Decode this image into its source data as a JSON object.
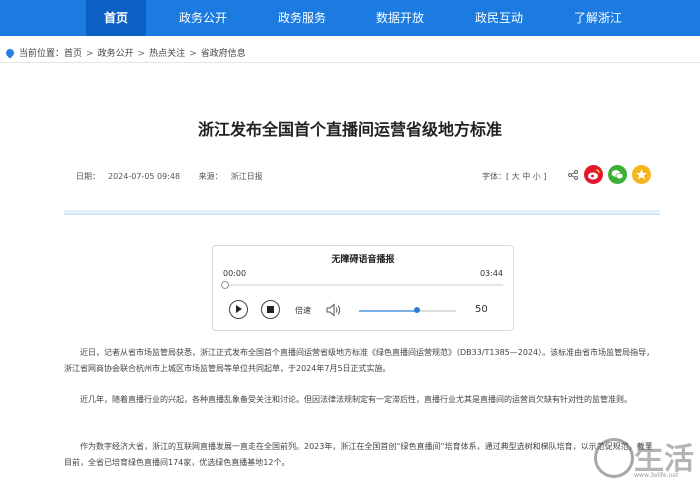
{
  "nav": {
    "items": [
      "首页",
      "政务公开",
      "政务服务",
      "数据开放",
      "政民互动",
      "了解浙江"
    ],
    "active_index": 0,
    "bg_color": "#1b7be0",
    "active_color": "#0d60c4"
  },
  "breadcrumb": {
    "icon": "location-pin-icon",
    "prefix": "当前位置：",
    "items": [
      "首页",
      "政务公开",
      "热点关注",
      "省政府信息"
    ],
    "separator": ">"
  },
  "article": {
    "title": "浙江发布全国首个直播间运营省级地方标准",
    "date_label": "日期：",
    "date": "2024-07-05 09:48",
    "source_label": "来源：",
    "source": "浙江日报",
    "font_label": "字体：",
    "font_open": "[",
    "font_options": [
      "大",
      "中",
      "小"
    ],
    "font_close": "]",
    "share_icons": [
      "share-icon",
      "weibo-icon",
      "wechat-icon",
      "favorite-icon"
    ],
    "paragraphs": [
      "近日，记者从省市场监管局获悉，浙江正式发布全国首个直播间运营省级地方标准《绿色直播间运营规范》（DB33/T1385—2024）。该标准由省市场监管局指导，浙江省网商协会联合杭州市上城区市场监管局等单位共同起草，于2024年7月5日正式实施。",
      "近几年，随着直播行业的兴起，各种直播乱象备受关注和讨论。但因法律法规制定有一定滞后性，直播行业尤其是直播间的运营尚欠缺有针对性的监管准则。",
      "作为数字经济大省，浙江的互联网直播发展一直走在全国前列。2023年，浙江在全国首创“绿色直播间”培育体系，通过典型选树和梯队培育，以示范促规范。截至目前，全省已培育绿色直播间174家，优选绿色直播基地12个。"
    ]
  },
  "player": {
    "title": "无障碍语音播报",
    "current_time": "00:00",
    "duration": "03:44",
    "progress": 0,
    "play_icon": "play-icon",
    "stop_icon": "stop-icon",
    "speed_label": "倍速",
    "volume_icon": "volume-icon",
    "volume": 50,
    "volume_text": "50"
  },
  "watermark": {
    "text": "生活",
    "url": "www.3elife.net"
  }
}
